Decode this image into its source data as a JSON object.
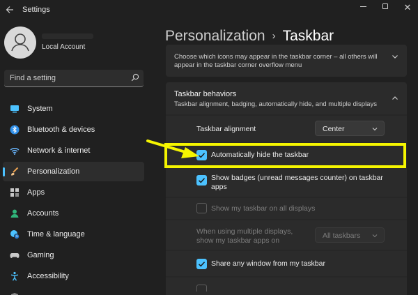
{
  "window": {
    "title": "Settings",
    "back_icon": "arrow-left-icon",
    "controls": [
      "minimize-icon",
      "maximize-icon",
      "close-icon"
    ]
  },
  "account": {
    "name": "Local Account",
    "avatar_icon": "person-icon"
  },
  "search": {
    "placeholder": "Find a setting",
    "icon": "search-icon"
  },
  "sidebar": {
    "items": [
      {
        "label": "System",
        "icon": "monitor-icon",
        "color": "#4cc2ff"
      },
      {
        "label": "Bluetooth & devices",
        "icon": "bluetooth-icon",
        "color": "#2f8fe8"
      },
      {
        "label": "Network & internet",
        "icon": "wifi-icon",
        "color": "#6ab7ff"
      },
      {
        "label": "Personalization",
        "icon": "brush-icon",
        "color": "#e8a050",
        "active": true
      },
      {
        "label": "Apps",
        "icon": "apps-icon",
        "color": "#c8c8c8"
      },
      {
        "label": "Accounts",
        "icon": "person-icon",
        "color": "#30b57a"
      },
      {
        "label": "Time & language",
        "icon": "globe-clock-icon",
        "color": "#4cc2ff"
      },
      {
        "label": "Gaming",
        "icon": "gamepad-icon",
        "color": "#c8c8c8"
      },
      {
        "label": "Accessibility",
        "icon": "accessibility-icon",
        "color": "#4cc2ff"
      }
    ]
  },
  "breadcrumb": {
    "parent": "Personalization",
    "separator": "›",
    "current": "Taskbar"
  },
  "corner_overflow": {
    "description": "Choose which icons may appear in the taskbar corner – all others will appear in the taskbar corner overflow menu"
  },
  "behaviors": {
    "title": "Taskbar behaviors",
    "subtitle": "Taskbar alignment, badging, automatically hide, and multiple displays",
    "alignment": {
      "label": "Taskbar alignment",
      "value": "Center"
    },
    "auto_hide": {
      "label": "Automatically hide the taskbar",
      "checked": true
    },
    "badges": {
      "label": "Show badges (unread messages counter) on taskbar apps",
      "checked": true
    },
    "all_displays": {
      "label": "Show my taskbar on all displays",
      "checked": false,
      "disabled": true
    },
    "multi_display": {
      "label": "When using multiple displays, show my taskbar apps on",
      "value": "All taskbars",
      "disabled": true
    },
    "share_window": {
      "label": "Share any window from my taskbar",
      "checked": true
    }
  },
  "colors": {
    "accent": "#4cc2ff",
    "highlight": "#f5f500",
    "background": "#202020",
    "card": "#2b2b2b"
  }
}
